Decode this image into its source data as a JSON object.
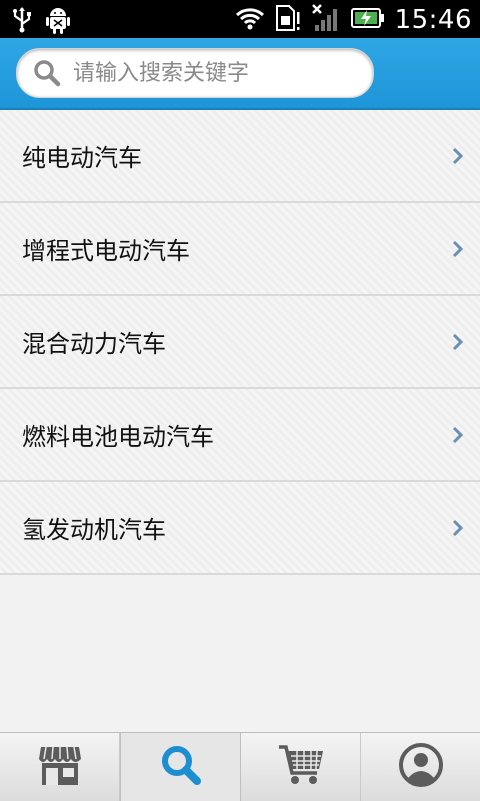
{
  "status_bar": {
    "time": "15:46",
    "icons": [
      "usb-icon",
      "android-debug-icon",
      "wifi-icon",
      "sim-icon",
      "no-signal-icon",
      "battery-charging-icon"
    ]
  },
  "search": {
    "placeholder": "请输入搜索关键字",
    "value": ""
  },
  "categories": [
    {
      "label": "纯电动汽车"
    },
    {
      "label": "增程式电动汽车"
    },
    {
      "label": "混合动力汽车"
    },
    {
      "label": "燃料电池电动汽车"
    },
    {
      "label": "氢发动机汽车"
    }
  ],
  "bottom_nav": {
    "tabs": [
      {
        "icon": "store-icon",
        "active": false
      },
      {
        "icon": "search-icon",
        "active": true
      },
      {
        "icon": "cart-icon",
        "active": false
      },
      {
        "icon": "profile-icon",
        "active": false
      }
    ]
  },
  "colors": {
    "header_blue": "#1e95d8",
    "active_icon_blue": "#1d8fd0",
    "icon_gray": "#5c5c5c",
    "chevron_blue": "#6a8fb3"
  }
}
